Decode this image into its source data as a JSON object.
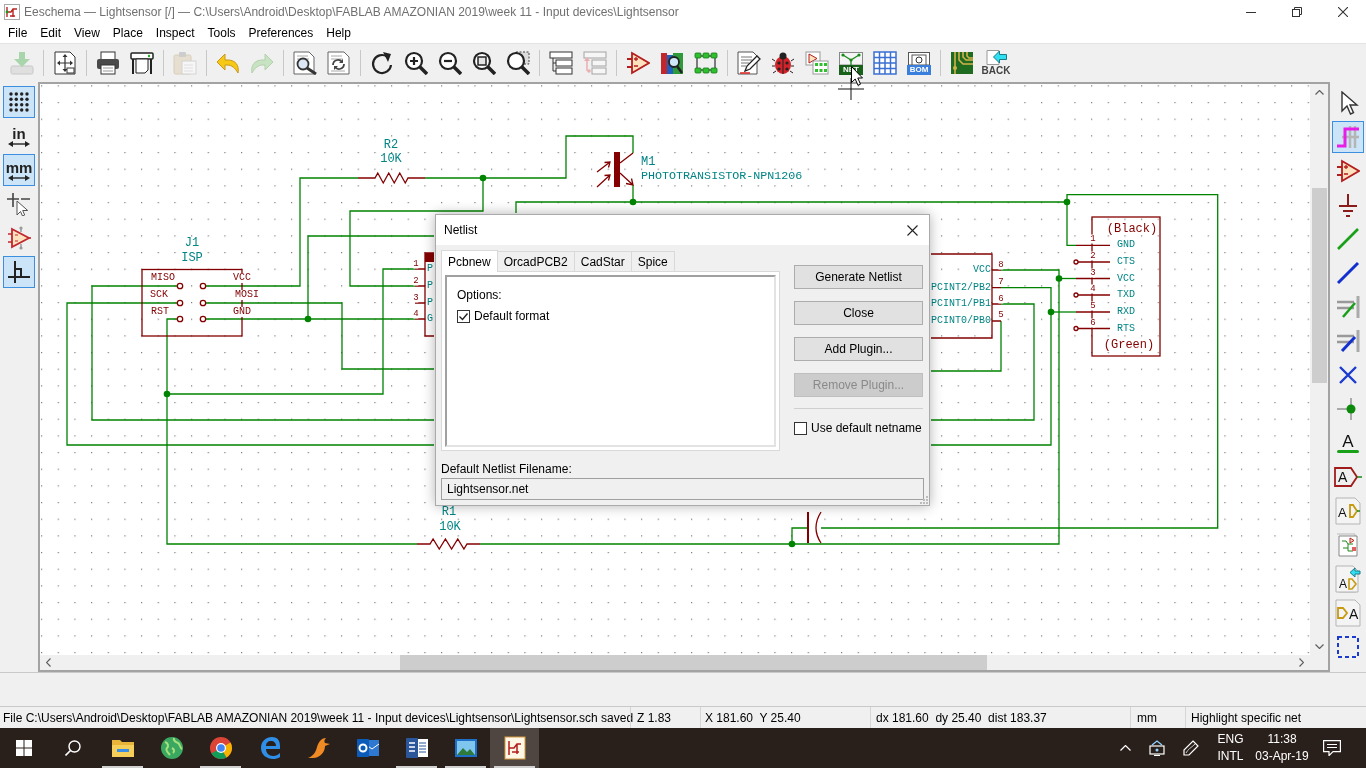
{
  "title_bar": {
    "title": "Eeschema — Lightsensor [/] — C:\\Users\\Android\\Desktop\\FABLAB AMAZONIAN 2019\\week 11 - Input devices\\Lightsensor"
  },
  "menu": [
    "File",
    "Edit",
    "View",
    "Place",
    "Inspect",
    "Tools",
    "Preferences",
    "Help"
  ],
  "toolbar": [
    [
      {
        "disabled": true
      }
    ],
    [
      {
        "disabled": false
      }
    ],
    [
      {
        "disabled": false
      },
      {
        "disabled": false
      }
    ],
    [
      {
        "disabled": true
      }
    ],
    [
      {
        "disabled": false
      },
      {
        "disabled": true
      }
    ],
    [
      {
        "disabled": false
      },
      {
        "disabled": false
      }
    ],
    [
      {
        "disabled": false
      },
      {
        "disabled": false
      },
      {
        "disabled": false
      },
      {
        "disabled": false
      },
      {
        "disabled": false
      }
    ],
    [
      {
        "disabled": false
      },
      {
        "disabled": true
      }
    ],
    [
      {
        "disabled": false
      },
      {
        "disabled": false
      },
      {
        "disabled": false
      }
    ],
    [
      {
        "disabled": false
      },
      {
        "disabled": false
      },
      {
        "disabled": false
      },
      {
        "disabled": false,
        "label": "NET"
      },
      {
        "disabled": false
      },
      {
        "disabled": false,
        "label": "BOM"
      }
    ],
    [
      {
        "disabled": false
      },
      {
        "disabled": false,
        "label": "BACK"
      }
    ]
  ],
  "left_toolbar": [
    {
      "selected": true
    },
    {
      "selected": false,
      "label": "in"
    },
    {
      "selected": true,
      "label": "mm"
    },
    {
      "selected": false
    },
    {
      "selected": false
    },
    {
      "selected": true
    }
  ],
  "right_toolbar": [
    {
      "selected": false
    },
    {
      "selected": true
    },
    {
      "selected": false
    },
    {
      "selected": false
    },
    {
      "selected": false
    },
    {
      "selected": false
    },
    {
      "selected": false
    },
    {
      "selected": false
    },
    {
      "selected": false
    },
    {
      "selected": false
    },
    {
      "selected": false,
      "label": "A"
    },
    {
      "selected": false,
      "label": "A"
    },
    {
      "selected": false,
      "label": "A"
    },
    {
      "selected": false
    },
    {
      "selected": false,
      "label": "A"
    },
    {
      "selected": false,
      "label": "A"
    },
    {
      "selected": false
    }
  ],
  "schematic": {
    "components": [
      {
        "reference": "R2",
        "value": "10K"
      },
      {
        "reference": "M1",
        "value": "PHOTOTRANSISTOR-NPN1206"
      },
      {
        "reference": "J1",
        "value": "ISP",
        "pins": [
          {
            "name": "MISO"
          },
          {
            "name": "VCC"
          },
          {
            "name": "SCK"
          },
          {
            "name": "MOSI"
          },
          {
            "name": "RST"
          },
          {
            "name": "GND"
          }
        ]
      },
      {
        "pins": [
          {
            "number": "1",
            "name": "P"
          },
          {
            "number": "2",
            "name": "P"
          },
          {
            "number": "3",
            "name": "P"
          },
          {
            "number": "4",
            "name": "G"
          }
        ]
      },
      {
        "pins": [
          {
            "name": "VCC",
            "number": "8"
          },
          {
            "name": "PCINT2/PB2",
            "number": "7"
          },
          {
            "name": "PCINT1/PB1",
            "number": "6"
          },
          {
            "name": "PCINT0/PB0",
            "number": "5"
          }
        ]
      },
      {
        "top_note": "(Black)",
        "pins": [
          {
            "number": "1",
            "name": "GND"
          },
          {
            "number": "2",
            "name": "CTS"
          },
          {
            "number": "3",
            "name": "VCC"
          },
          {
            "number": "4",
            "name": "TXD"
          },
          {
            "number": "5",
            "name": "RXD"
          },
          {
            "number": "6",
            "name": "RTS"
          }
        ],
        "bottom_note": "(Green)"
      },
      {
        "reference": "R1",
        "value": "10K"
      }
    ]
  },
  "dialog": {
    "title": "Netlist",
    "tabs": [
      {
        "label": "Pcbnew",
        "selected": true
      },
      {
        "label": "OrcadPCB2",
        "selected": false
      },
      {
        "label": "CadStar",
        "selected": false
      },
      {
        "label": "Spice",
        "selected": false
      }
    ],
    "options_label": "Options:",
    "options": [
      {
        "label": "Default format",
        "checked": true
      }
    ],
    "buttons": [
      {
        "label": "Generate Netlist",
        "disabled": false
      },
      {
        "label": "Close",
        "disabled": false
      },
      {
        "label": "Add Plugin...",
        "disabled": false
      },
      {
        "label": "Remove Plugin...",
        "disabled": true
      }
    ],
    "netname_option": {
      "label": "Use default netname",
      "checked": false
    },
    "filename_label": "Default Netlist Filename:",
    "filename": {
      "value": "Lightsensor.net"
    }
  },
  "status_bar": [
    "File C:\\Users\\Android\\Desktop\\FABLAB AMAZONIAN 2019\\week 11 - Input devices\\Lightsensor\\Lightsensor.sch saved",
    "Z 1.83",
    "X 181.60  Y 25.40",
    "dx 181.60  dy 25.40  dist 183.37",
    "mm",
    "Highlight specific net"
  ],
  "taskbar": {
    "apps": [
      {
        "selected": false,
        "running": true
      },
      {
        "selected": false,
        "running": false
      },
      {
        "selected": false,
        "running": true
      },
      {
        "selected": false,
        "running": false
      },
      {
        "selected": false,
        "running": false
      },
      {
        "selected": false,
        "running": false
      },
      {
        "selected": false,
        "running": true
      },
      {
        "selected": false,
        "running": true
      },
      {
        "selected": true,
        "running": true
      }
    ],
    "tray": {
      "language": "ENG",
      "layout": "INTL",
      "time": "11:38",
      "date": "03-Apr-19"
    }
  }
}
